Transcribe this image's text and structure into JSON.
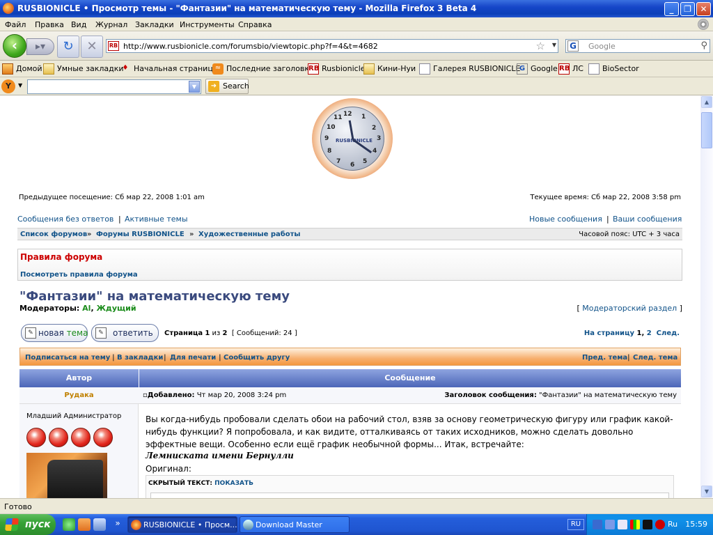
{
  "window": {
    "title": "RUSBIONICLE • Просмотр темы - \"Фантазии\" на математическую тему - Mozilla Firefox 3 Beta 4",
    "min_icon": "minimize-icon",
    "max_icon": "maximize-icon",
    "close_icon": "close-icon"
  },
  "menu": [
    "Файл",
    "Правка",
    "Вид",
    "Журнал",
    "Закладки",
    "Инструменты",
    "Справка"
  ],
  "nav": {
    "url": "http://www.rusbionicle.com/forumsbio/viewtopic.php?f=4&t=4682",
    "search_placeholder": "Google",
    "search_engine_icon": "G"
  },
  "bookmarks": [
    {
      "label": "Домой",
      "icon": "home-icon"
    },
    {
      "label": "Умные закладки",
      "icon": "folder-icon"
    },
    {
      "label": "Начальная страница",
      "icon": "redhat-icon"
    },
    {
      "label": "Последние заголовки",
      "icon": "rss-icon"
    },
    {
      "label": "Rusbionicle",
      "icon": "rb-icon"
    },
    {
      "label": "Кини-Нуи",
      "icon": "folder-icon"
    },
    {
      "label": "Галерея RUSBIONICLE",
      "icon": "page-icon"
    },
    {
      "label": "Google",
      "icon": "google-icon"
    },
    {
      "label": "ЛС",
      "icon": "rb-icon"
    },
    {
      "label": "BioSector",
      "icon": "page-icon"
    }
  ],
  "yahoo_bar": {
    "search_label": "Search"
  },
  "forum": {
    "last_visit": "Предыдущее посещение: Сб мар 22, 2008 1:01 am",
    "current_time": "Текущее время: Сб мар 22, 2008 3:58 pm",
    "links_left": [
      "Сообщения без ответов",
      "Активные темы"
    ],
    "links_right": [
      "Новые сообщения",
      "Ваши сообщения"
    ],
    "breadcrumb": [
      "Список форумов",
      "Форумы RUSBIONICLE",
      "Художественные работы"
    ],
    "timezone": "Часовой пояс: UTC + 3 часа",
    "rules_title": "Правила форума",
    "rules_link": "Посмотреть правила форума",
    "topic_title": "\"Фантазии\" на математическую тему",
    "moderators_label": "Модераторы:",
    "moderators": [
      "Al",
      "Ждущий"
    ],
    "mod_section": "Модераторский раздел",
    "new_topic": {
      "a": "новая ",
      "b": "тема"
    },
    "reply": "ответить",
    "page_info": {
      "prefix": "Страница",
      "cur": "1",
      "of": "из",
      "total": "2",
      "count": "[ Сообщений: 24 ]"
    },
    "page_nav": {
      "label": "На страницу",
      "p1": "1",
      "p2": "2",
      "next": "След."
    },
    "actions": [
      "Подписаться на тему",
      "В закладки",
      "Для печати",
      "Сообщить другу"
    ],
    "topic_nav": [
      "Пред. тема",
      "След. тема"
    ],
    "col_author": "Автор",
    "col_message": "Сообщение",
    "post": {
      "author": "Рудака",
      "rank": "Младший Администратор",
      "posted_label": "Добавлено:",
      "posted_date": "Чт мар 20, 2008 3:24 pm",
      "subject_label": "Заголовок сообщения:",
      "subject": "\"Фантазии\" на математическую тему",
      "body": "Вы когда-нибудь пробовали сделать обои на рабочий стол, взяв за основу геометрическую фигуру или график какой-нибудь функции? Я попробовала, и как видите, отталкиваясь от таких исходников, можно сделать довольно эффектные вещи. Особенно если ещё график необычной формы... Итак, встречайте:",
      "heading": "Лемниската имени Бернулли",
      "original": "Оригинал:",
      "hidden_label": "СКРЫТЫЙ ТЕКСТ",
      "hidden_show": "ПОКАЗАТЬ"
    },
    "clock": {
      "brand": "RUSBIONICLE",
      "numbers": [
        "12",
        "1",
        "2",
        "3",
        "4",
        "5",
        "6",
        "7",
        "8",
        "9",
        "10",
        "11"
      ]
    }
  },
  "status": "Готово",
  "taskbar": {
    "start": "пуск",
    "tasks": [
      "RUSBIONICLE • Просм...",
      "Download Master"
    ],
    "lang": "RU",
    "tray_lang": "Ru",
    "time": "15:59"
  }
}
